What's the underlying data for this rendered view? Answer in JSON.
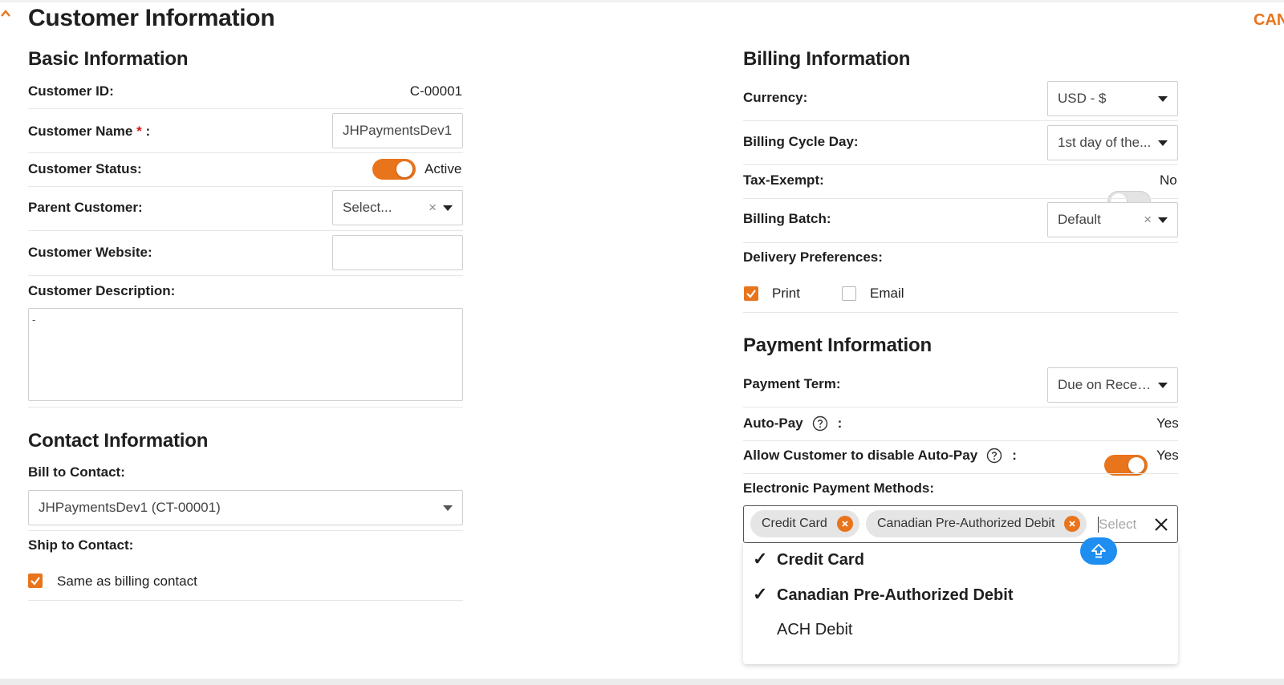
{
  "header": {
    "title": "Customer Information",
    "cancel_label": "CAN"
  },
  "basic_info": {
    "title": "Basic Information",
    "customer_id_label": "Customer ID:",
    "customer_id_value": "C-00001",
    "customer_name_label": "Customer Name",
    "required_mark": "*",
    "colon": ":",
    "customer_name_value": "JHPaymentsDev1",
    "customer_status_label": "Customer Status:",
    "customer_status_value": "Active",
    "customer_status_on": true,
    "parent_customer_label": "Parent Customer:",
    "parent_customer_placeholder": "Select...",
    "customer_website_label": "Customer Website:",
    "customer_website_value": "",
    "customer_description_label": "Customer Description:",
    "customer_description_value": "-"
  },
  "contact_info": {
    "title": "Contact Information",
    "bill_to_label": "Bill to Contact:",
    "bill_to_value": "JHPaymentsDev1 (CT-00001)",
    "ship_to_label": "Ship to Contact:",
    "same_as_billing_label": "Same as billing contact",
    "same_as_billing_checked": true
  },
  "billing_info": {
    "title": "Billing Information",
    "currency_label": "Currency:",
    "currency_value": "USD - $",
    "billing_cycle_label": "Billing Cycle Day:",
    "billing_cycle_value": "1st day of the...",
    "tax_exempt_label": "Tax-Exempt:",
    "tax_exempt_value": "No",
    "tax_exempt_on": false,
    "billing_batch_label": "Billing Batch:",
    "billing_batch_value": "Default",
    "delivery_label": "Delivery Preferences:",
    "delivery_print_label": "Print",
    "delivery_print_checked": true,
    "delivery_email_label": "Email",
    "delivery_email_checked": false
  },
  "payment_info": {
    "title": "Payment Information",
    "payment_term_label": "Payment Term:",
    "payment_term_value": "Due on Receipt",
    "auto_pay_label": "Auto-Pay",
    "auto_pay_value": "Yes",
    "auto_pay_on": true,
    "allow_disable_label": "Allow Customer to disable Auto-Pay",
    "allow_disable_value": "Yes",
    "allow_disable_on": true,
    "colon": ":",
    "epm_label": "Electronic Payment Methods:",
    "epm_selected": [
      "Credit Card",
      "Canadian Pre-Authorized Debit"
    ],
    "epm_placeholder": "Select",
    "epm_options": [
      {
        "label": "Credit Card",
        "selected": true
      },
      {
        "label": "Canadian Pre-Authorized Debit",
        "selected": true
      },
      {
        "label": "ACH Debit",
        "selected": false
      }
    ],
    "check_glyph": "✓"
  },
  "colors": {
    "accent": "#e8741c",
    "required": "#d01818",
    "fab": "#1f8ef1"
  },
  "icons": {
    "collapse": "chevron-up-icon",
    "caret": "caret-down-icon",
    "clear": "clear-x-icon",
    "help": "question-circle-icon",
    "chip_remove": "remove-circle-x-icon",
    "close": "close-icon",
    "fab": "scroll-up-icon"
  }
}
